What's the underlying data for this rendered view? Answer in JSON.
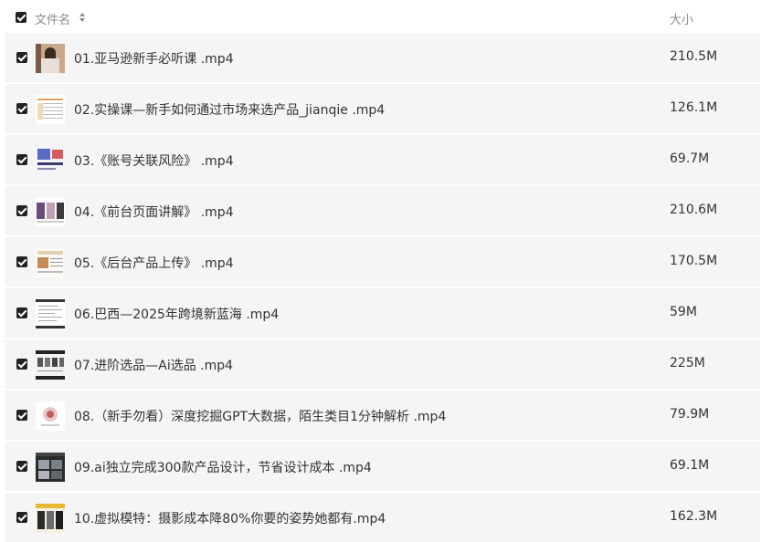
{
  "header": {
    "name_label": "文件名",
    "size_label": "大小"
  },
  "files": [
    {
      "name": "01.亚马逊新手必听课 .mp4",
      "size": "210.5M",
      "thumb": "thumb-woman-portrait"
    },
    {
      "name": "02.实操课—新手如何通过市场来选产品_jianqie .mp4",
      "size": "126.1M",
      "thumb": "thumb-spreadsheet"
    },
    {
      "name": "03.《账号关联风险》 .mp4",
      "size": "69.7M",
      "thumb": "thumb-slides"
    },
    {
      "name": "04.《前台页面讲解》 .mp4",
      "size": "210.6M",
      "thumb": "thumb-product-page"
    },
    {
      "name": "05.《后台产品上传》 .mp4",
      "size": "170.5M",
      "thumb": "thumb-backend"
    },
    {
      "name": "06.巴西—2025年跨境新蓝海 .mp4",
      "size": "59M",
      "thumb": "thumb-document"
    },
    {
      "name": "07.进阶选品—Ai选品 .mp4",
      "size": "225M",
      "thumb": "thumb-dark-list"
    },
    {
      "name": "08.（新手勿看）深度挖掘GPT大数据，陌生类目1分钟解析 .mp4",
      "size": "79.9M",
      "thumb": "thumb-white-card"
    },
    {
      "name": "09.ai独立完成300款产品设计，节省设计成本 .mp4",
      "size": "69.1M",
      "thumb": "thumb-dark-editor"
    },
    {
      "name": "10.虚拟模特：摄影成本降80%你要的姿势她都有.mp4",
      "size": "162.3M",
      "thumb": "thumb-model-grid"
    }
  ],
  "colors": {
    "row_background": "#f5f5f5",
    "checkbox": "#222222",
    "header_text": "#8a8a8a",
    "text": "#333333"
  }
}
